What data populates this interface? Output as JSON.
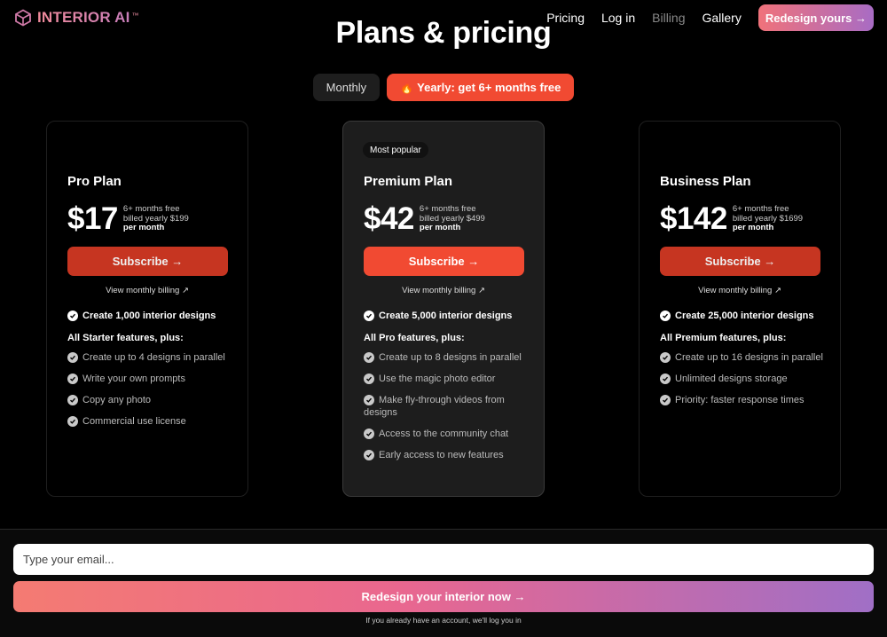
{
  "header": {
    "logo_text": "INTERIOR AI",
    "logo_tm": "™",
    "nav": [
      {
        "label": "Pricing"
      },
      {
        "label": "Log in"
      },
      {
        "label": "Billing"
      },
      {
        "label": "Gallery"
      }
    ],
    "cta_label": "Redesign yours →"
  },
  "page_title": "Plans & pricing",
  "billing_toggle": {
    "monthly_label": "Monthly",
    "yearly_label": "Yearly: get 6+ months free",
    "yearly_icon": "flame-icon",
    "selected": "yearly"
  },
  "plans": [
    {
      "name": "Pro Plan",
      "price": "$17",
      "free_note": "6+ months free",
      "billed_note": "billed yearly $199",
      "per_month": "per month",
      "subscribe_label": "Subscribe →",
      "view_monthly": "View monthly billing ↗",
      "main_feature": "Create 1,000 interior designs",
      "subheading": "All Starter features, plus:",
      "features": [
        "Create up to 4 designs in parallel",
        "Write your own prompts",
        "Copy any photo",
        "Commercial use license"
      ]
    },
    {
      "name": "Premium Plan",
      "badge": "Most popular",
      "price": "$42",
      "free_note": "6+ months free",
      "billed_note": "billed yearly $499",
      "per_month": "per month",
      "subscribe_label": "Subscribe →",
      "view_monthly": "View monthly billing ↗",
      "main_feature": "Create 5,000 interior designs",
      "subheading": "All Pro features, plus:",
      "features": [
        "Create up to 8 designs in parallel",
        "Use the magic photo editor",
        "Make fly-through videos from designs",
        "Access to the community chat",
        "Early access to new features"
      ]
    },
    {
      "name": "Business Plan",
      "price": "$142",
      "free_note": "6+ months free",
      "billed_note": "billed yearly $1699",
      "per_month": "per month",
      "subscribe_label": "Subscribe →",
      "view_monthly": "View monthly billing ↗",
      "main_feature": "Create 25,000 interior designs",
      "subheading": "All Premium features, plus:",
      "features": [
        "Create up to 16 designs in parallel",
        "Unlimited designs storage",
        "Priority: faster response times"
      ]
    }
  ],
  "signup": {
    "email_placeholder": "Type your email...",
    "cta_label": "Redesign your interior now →",
    "note": "If you already have an account, we'll log you in"
  },
  "colors": {
    "accent": "#f14a32",
    "accent_dim": "#c63521",
    "gradient_start": "#f47b72",
    "gradient_end": "#a06fc6"
  }
}
